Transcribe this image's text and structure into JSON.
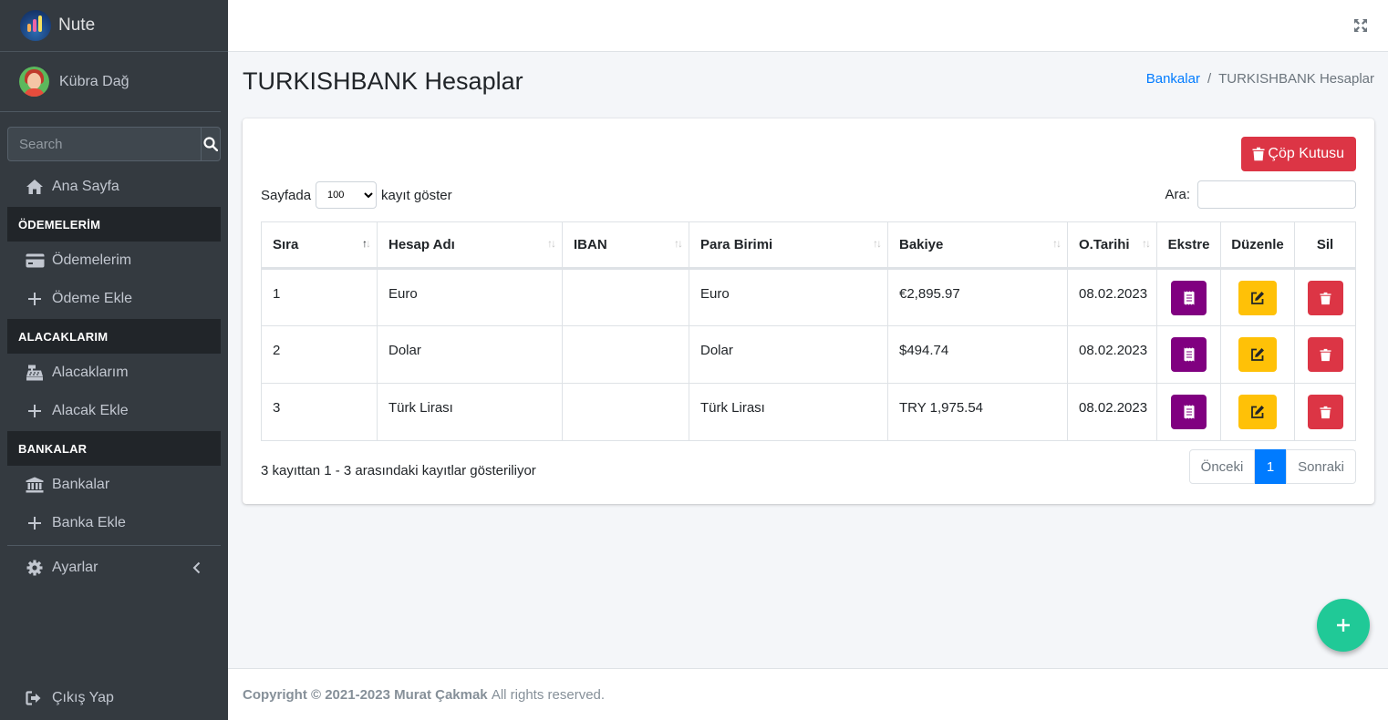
{
  "brand": {
    "name": "Nute"
  },
  "user": {
    "name": "Kübra Dağ"
  },
  "search": {
    "placeholder": "Search"
  },
  "sidebar": {
    "home": "Ana Sayfa",
    "section_payments": "ÖDEMELERİM",
    "payments": "Ödemelerim",
    "add_payment": "Ödeme Ekle",
    "section_receivables": "ALACAKLARIM",
    "receivables": "Alacaklarım",
    "add_receivable": "Alacak Ekle",
    "section_banks": "BANKALAR",
    "banks": "Bankalar",
    "add_bank": "Banka Ekle",
    "settings": "Ayarlar",
    "logout": "Çıkış Yap"
  },
  "page": {
    "title": "TURKISHBANK Hesaplar",
    "breadcrumb": {
      "parent": "Bankalar",
      "current": "TURKISHBANK Hesaplar"
    }
  },
  "card": {
    "trash_label": "Çöp Kutusu",
    "length_prefix": "Sayfada",
    "length_value": "100",
    "length_suffix": "kayıt göster",
    "filter_label": "Ara:"
  },
  "table": {
    "headers": [
      "Sıra",
      "Hesap Adı",
      "IBAN",
      "Para Birimi",
      "Bakiye",
      "O.Tarihi",
      "Ekstre",
      "Düzenle",
      "Sil"
    ],
    "rows": [
      {
        "no": "1",
        "name": "Euro",
        "iban": "",
        "currency": "Euro",
        "balance": "€2,895.97",
        "date": "08.02.2023"
      },
      {
        "no": "2",
        "name": "Dolar",
        "iban": "",
        "currency": "Dolar",
        "balance": "$494.74",
        "date": "08.02.2023"
      },
      {
        "no": "3",
        "name": "Türk Lirası",
        "iban": "",
        "currency": "Türk Lirası",
        "balance": "TRY 1,975.54",
        "date": "08.02.2023"
      }
    ]
  },
  "info": "3 kayıttan 1 - 3 arasındaki kayıtlar gösteriliyor",
  "pagination": {
    "prev": "Önceki",
    "current": "1",
    "next": "Sonraki"
  },
  "footer": {
    "copyright": "Copyright © 2021-2023 Murat Çakmak",
    "rights": "All rights reserved."
  },
  "colors": {
    "sidebar": "#343a40",
    "danger": "#dc3545",
    "warning": "#ffc107",
    "purple": "#800080",
    "primary": "#007bff",
    "teal": "#20c997"
  }
}
